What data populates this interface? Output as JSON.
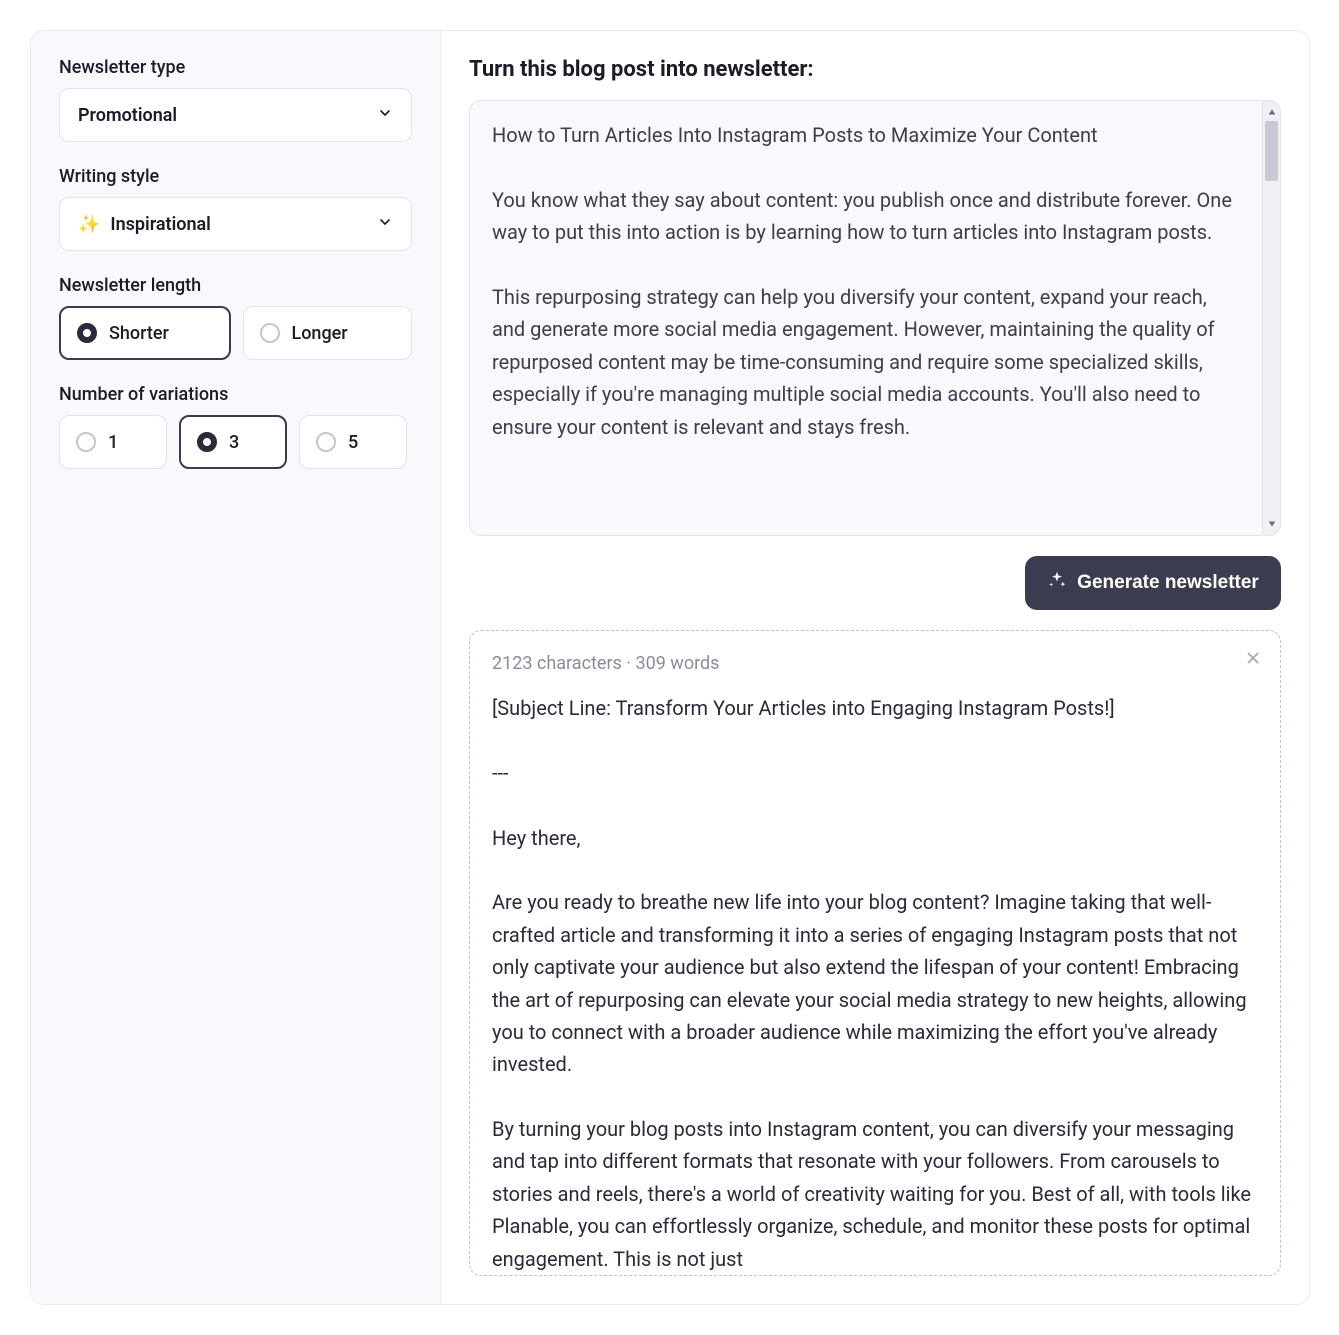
{
  "sidebar": {
    "newsletter_type": {
      "label": "Newsletter type",
      "value": "Promotional"
    },
    "writing_style": {
      "label": "Writing style",
      "icon": "✨",
      "value": "Inspirational"
    },
    "length": {
      "label": "Newsletter length",
      "options": [
        {
          "label": "Shorter",
          "selected": true
        },
        {
          "label": "Longer",
          "selected": false
        }
      ]
    },
    "variations": {
      "label": "Number of variations",
      "options": [
        {
          "label": "1",
          "selected": false
        },
        {
          "label": "3",
          "selected": true
        },
        {
          "label": "5",
          "selected": false
        }
      ]
    }
  },
  "main": {
    "title": "Turn this blog post into newsletter:",
    "source_text": "How to Turn Articles Into Instagram Posts to Maximize Your Content\n\nYou know what they say about content: you publish once and distribute forever. One way to put this into action is by learning how to turn articles into Instagram posts.\n\nThis repurposing strategy can help you diversify your content, expand your reach, and generate more social media engagement. However, maintaining the quality of repurposed content may be time-consuming and require some specialized skills, especially if you're managing multiple social media accounts. You'll also need to ensure your content is relevant and stays fresh.",
    "generate_button": "Generate newsletter"
  },
  "result": {
    "characters": "2123 characters",
    "words": "309 words",
    "separator": " · ",
    "body": "[Subject Line: Transform Your Articles into Engaging Instagram Posts!]\n\n---\n\nHey there,\n\nAre you ready to breathe new life into your blog content? Imagine taking that well-crafted article and transforming it into a series of engaging Instagram posts that not only captivate your audience but also extend the lifespan of your content! Embracing the art of repurposing can elevate your social media strategy to new heights, allowing you to connect with a broader audience while maximizing the effort you've already invested.\n\nBy turning your blog posts into Instagram content, you can diversify your messaging and tap into different formats that resonate with your followers. From carousels to stories and reels, there's a world of creativity waiting for you. Best of all, with tools like Planable, you can effortlessly organize, schedule, and monitor these posts for optimal engagement. This is not just"
  }
}
